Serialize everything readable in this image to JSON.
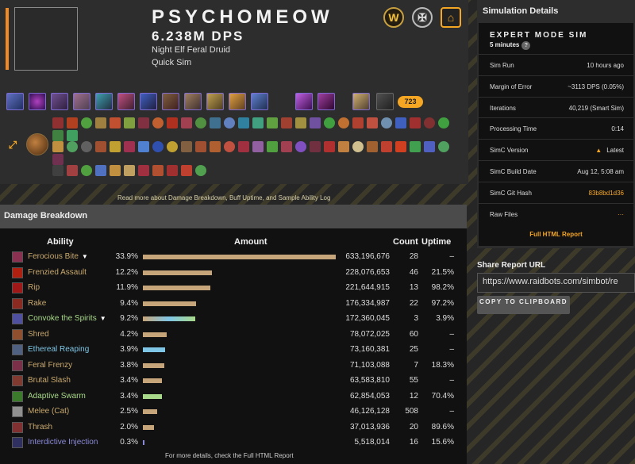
{
  "header": {
    "character_name": "PSYCHOMEOW",
    "dps": "6.238M DPS",
    "spec": "Night Elf Feral Druid",
    "sim_type": "Quick Sim",
    "item_level": "723",
    "badge_icons": [
      "wow-logo-icon",
      "pvp-crest-icon",
      "guild-house-icon"
    ]
  },
  "stripe_link": "Read more about Damage Breakdown, Buff Uptime, and Sample Ability Log",
  "damage_breakdown": {
    "title": "Damage Breakdown",
    "columns": {
      "ability": "Ability",
      "amount": "Amount",
      "count": "Count",
      "uptime": "Uptime"
    },
    "rows": [
      {
        "name": "Ferocious Bite",
        "expand": "▼",
        "pct": "33.9%",
        "share": 0.339,
        "amount": "633,196,676",
        "count": "28",
        "uptime": "–",
        "name_color": "#c9a96e",
        "bar_color": "#c7a57a",
        "icon_color": "#8a3050"
      },
      {
        "name": "Frenzied Assault",
        "expand": "",
        "pct": "12.2%",
        "share": 0.122,
        "amount": "228,076,653",
        "count": "46",
        "uptime": "21.5%",
        "name_color": "#c9a96e",
        "bar_color": "#c7a57a",
        "icon_color": "#b02010"
      },
      {
        "name": "Rip",
        "expand": "",
        "pct": "11.9%",
        "share": 0.119,
        "amount": "221,644,915",
        "count": "13",
        "uptime": "98.2%",
        "name_color": "#c9a96e",
        "bar_color": "#c7a57a",
        "icon_color": "#a01818"
      },
      {
        "name": "Rake",
        "expand": "",
        "pct": "9.4%",
        "share": 0.094,
        "amount": "176,334,987",
        "count": "22",
        "uptime": "97.2%",
        "name_color": "#c9a96e",
        "bar_color": "#c7a57a",
        "icon_color": "#8a2a20"
      },
      {
        "name": "Convoke the Spirits",
        "expand": "▼",
        "pct": "9.2%",
        "share": 0.092,
        "amount": "172,360,045",
        "count": "3",
        "uptime": "3.9%",
        "name_color": "#a8d88a",
        "bar_color": "#8ec9a0",
        "icon_color": "#5050a0"
      },
      {
        "name": "Shred",
        "expand": "",
        "pct": "4.2%",
        "share": 0.042,
        "amount": "78,072,025",
        "count": "60",
        "uptime": "–",
        "name_color": "#c9a96e",
        "bar_color": "#c7a57a",
        "icon_color": "#905030"
      },
      {
        "name": "Ethereal Reaping",
        "expand": "",
        "pct": "3.9%",
        "share": 0.039,
        "amount": "73,160,381",
        "count": "25",
        "uptime": "–",
        "name_color": "#7fc6e6",
        "bar_color": "#7fc6e6",
        "icon_color": "#506080"
      },
      {
        "name": "Feral Frenzy",
        "expand": "",
        "pct": "3.8%",
        "share": 0.038,
        "amount": "71,103,088",
        "count": "7",
        "uptime": "18.3%",
        "name_color": "#c9a96e",
        "bar_color": "#c7a57a",
        "icon_color": "#7a3048"
      },
      {
        "name": "Brutal Slash",
        "expand": "",
        "pct": "3.4%",
        "share": 0.034,
        "amount": "63,583,810",
        "count": "55",
        "uptime": "–",
        "name_color": "#c9a96e",
        "bar_color": "#c7a57a",
        "icon_color": "#803a30"
      },
      {
        "name": "Adaptive Swarm",
        "expand": "",
        "pct": "3.4%",
        "share": 0.034,
        "amount": "62,854,053",
        "count": "12",
        "uptime": "70.4%",
        "name_color": "#a8d88a",
        "bar_color": "#a8d88a",
        "icon_color": "#3a7a2a"
      },
      {
        "name": "Melee (Cat)",
        "expand": "",
        "pct": "2.5%",
        "share": 0.025,
        "amount": "46,126,128",
        "count": "508",
        "uptime": "–",
        "name_color": "#c9a96e",
        "bar_color": "#c7a57a",
        "icon_color": "#909090"
      },
      {
        "name": "Thrash",
        "expand": "",
        "pct": "2.0%",
        "share": 0.02,
        "amount": "37,013,936",
        "count": "20",
        "uptime": "89.6%",
        "name_color": "#c9a96e",
        "bar_color": "#c7a57a",
        "icon_color": "#803030"
      },
      {
        "name": "Interdictive Injection",
        "expand": "",
        "pct": "0.3%",
        "share": 0.003,
        "amount": "5,518,014",
        "count": "16",
        "uptime": "15.6%",
        "name_color": "#8a8ad8",
        "bar_color": "#8a8ad8",
        "icon_color": "#303060"
      }
    ],
    "footnote": "For more details, check the Full HTML Report"
  },
  "simulation_details": {
    "title": "Simulation Details",
    "mode_title": "EXPERT MODE SIM",
    "duration": "5 minutes",
    "help": "?",
    "rows": [
      {
        "label": "Sim Run",
        "value": "10 hours ago"
      },
      {
        "label": "Margin of Error",
        "value": "~3113 DPS (0.05%)"
      },
      {
        "label": "Iterations",
        "value": "40,219 (Smart Sim)"
      },
      {
        "label": "Processing Time",
        "value": "0:14"
      },
      {
        "label": "SimC Version",
        "value": "Latest"
      },
      {
        "label": "SimC Build Date",
        "value": "Aug 12, 5:08 am"
      },
      {
        "label": "SimC Git Hash",
        "value": "83b8bd1d36"
      },
      {
        "label": "Raw Files",
        "value": "···"
      }
    ],
    "full_report": "Full HTML Report"
  },
  "share": {
    "title": "Share Report URL",
    "url": "https://www.raidbots.com/simbot/re",
    "copy_label": "COPY TO CLIPBOARD"
  },
  "colors": {
    "accent": "#f5a623",
    "orange_bar": "#f08a24"
  }
}
